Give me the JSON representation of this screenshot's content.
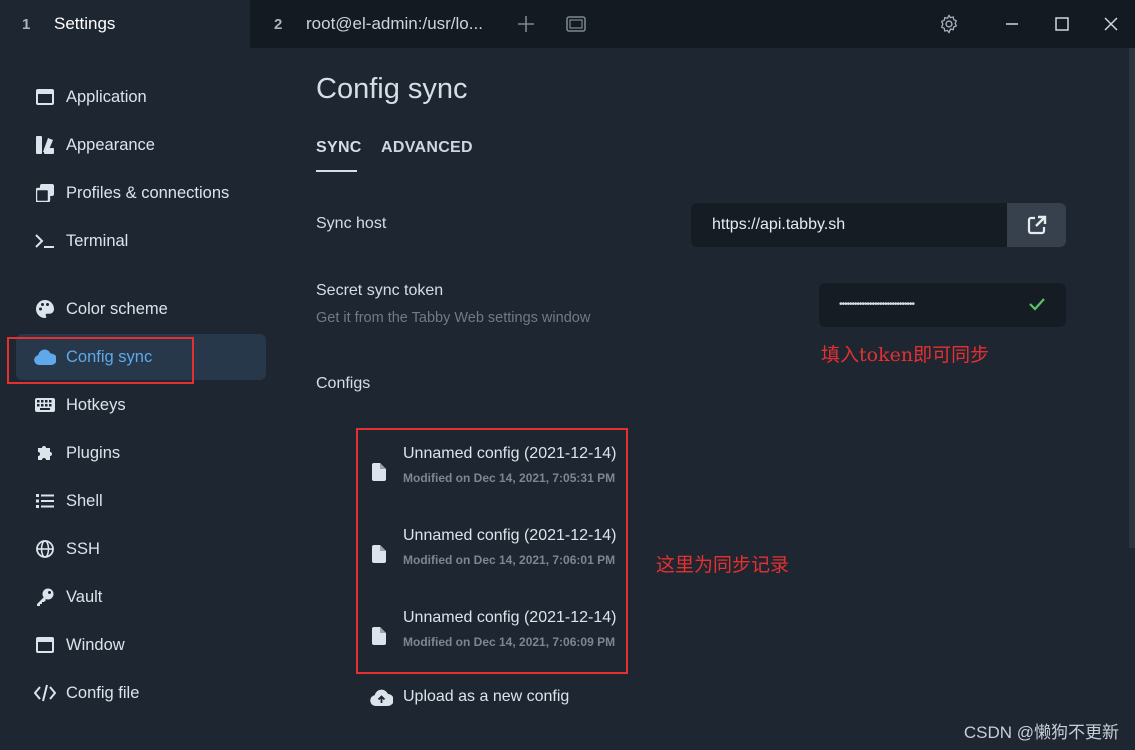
{
  "titlebar": {
    "tabs": [
      {
        "num": "1",
        "label": "Settings"
      },
      {
        "num": "2",
        "label": "root@el-admin:/usr/lo..."
      }
    ],
    "icons": [
      "plus-icon",
      "window-icon",
      "gear-icon",
      "minimize-icon",
      "maximize-icon",
      "close-icon"
    ]
  },
  "sidebar": {
    "items": [
      {
        "label": "Application",
        "icon": "application-icon"
      },
      {
        "label": "Appearance",
        "icon": "appearance-icon"
      },
      {
        "label": "Profiles & connections",
        "icon": "profiles-icon"
      },
      {
        "label": "Terminal",
        "icon": "terminal-icon"
      },
      {
        "label": "Color scheme",
        "icon": "palette-icon"
      },
      {
        "label": "Config sync",
        "icon": "cloud-icon"
      },
      {
        "label": "Hotkeys",
        "icon": "keyboard-icon"
      },
      {
        "label": "Plugins",
        "icon": "puzzle-icon"
      },
      {
        "label": "Shell",
        "icon": "list-icon"
      },
      {
        "label": "SSH",
        "icon": "globe-icon"
      },
      {
        "label": "Vault",
        "icon": "key-icon"
      },
      {
        "label": "Window",
        "icon": "window-icon"
      },
      {
        "label": "Config file",
        "icon": "code-icon"
      }
    ],
    "active": "Config sync"
  },
  "main": {
    "title": "Config sync",
    "tabs": [
      "SYNC",
      "ADVANCED"
    ],
    "sync_host": {
      "label": "Sync host",
      "value": "https://api.tabby.sh"
    },
    "secret_token": {
      "label": "Secret sync token",
      "hint": "Get it from the Tabby Web settings window",
      "value": "••••••••••••••••••••••••••••••"
    },
    "configs": {
      "label": "Configs",
      "items": [
        {
          "title": "Unnamed config (2021-12-14)",
          "modified": "Modified on Dec 14, 2021, 7:05:31 PM"
        },
        {
          "title": "Unnamed config (2021-12-14)",
          "modified": "Modified on Dec 14, 2021, 7:06:01 PM"
        },
        {
          "title": "Unnamed config (2021-12-14)",
          "modified": "Modified on Dec 14, 2021, 7:06:09 PM"
        }
      ]
    },
    "upload_label": "Upload as a new config"
  },
  "annotations": {
    "token_note": "填入token即可同步",
    "records_note": "这里为同步记录"
  },
  "watermark": "CSDN @懒狗不更新",
  "colors": {
    "accent": "#5fa8ea",
    "annotation": "#e53030",
    "check": "#5cc26b"
  }
}
